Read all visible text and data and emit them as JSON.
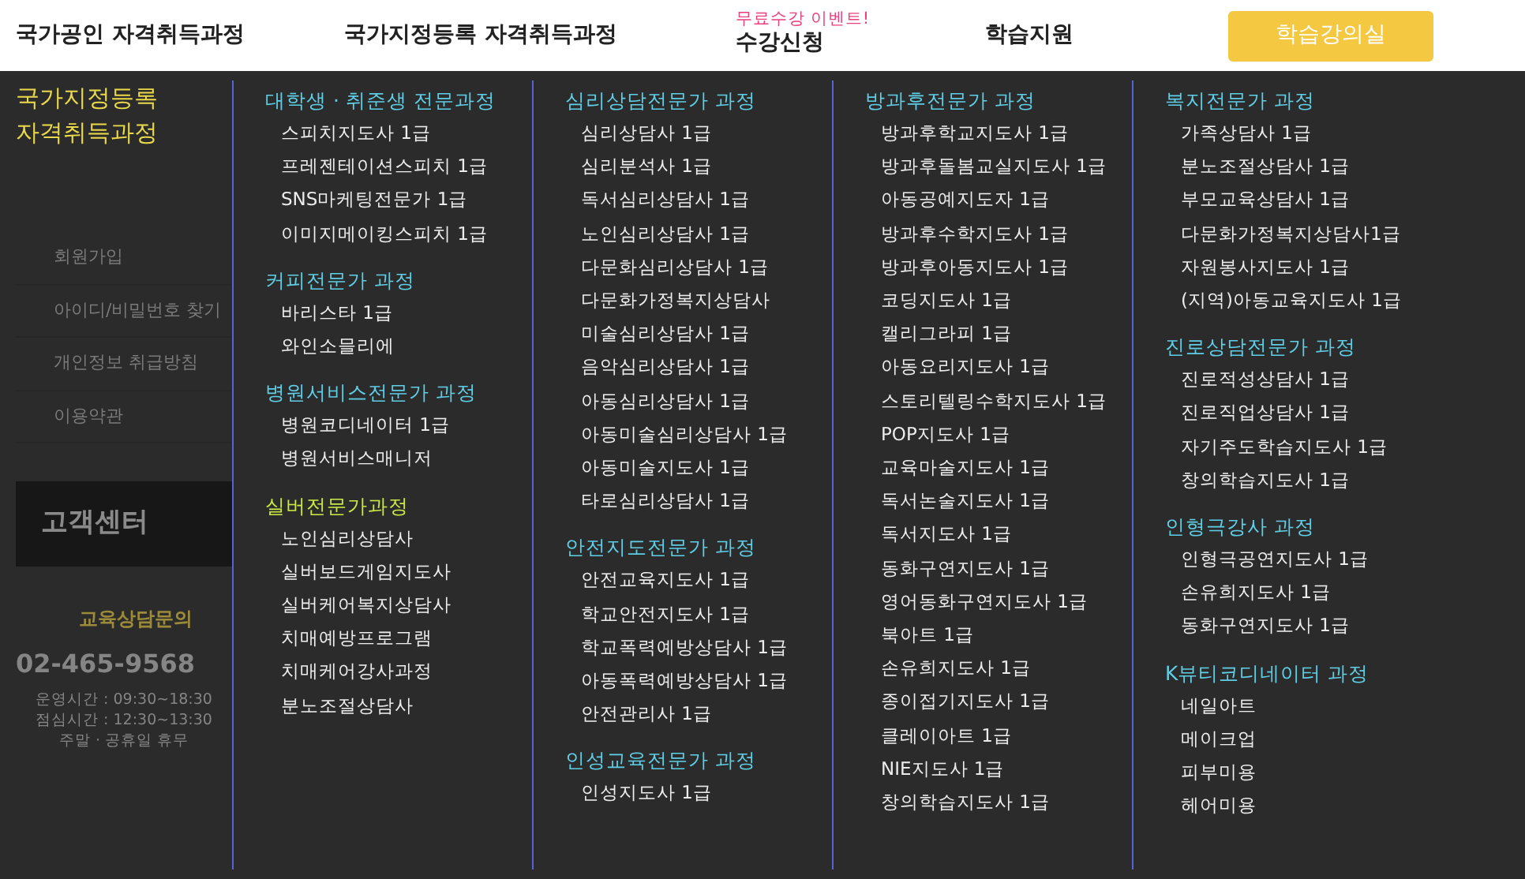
{
  "nav": {
    "items": [
      {
        "label": "국가공인 자격취득과정"
      },
      {
        "label": "국가지정등록 자격취득과정"
      },
      {
        "label": "수강신청",
        "badge": "무료수강 이벤트!"
      },
      {
        "label": "학습지원"
      }
    ],
    "button": "학습강의실"
  },
  "menu_title": "국가지정등록 자격취득과정",
  "sidebar": {
    "links": [
      "회원가입",
      "아이디/비밀번호 찾기",
      "개인정보 취급방침",
      "이용약관"
    ],
    "service_title": "고객센터",
    "contact_label": "교육상담문의",
    "phone": "02-465-9568",
    "hours": [
      "운영시간 : 09:30~18:30",
      "점심시간 : 12:30~13:30",
      "주말 · 공휴일 휴무"
    ]
  },
  "columns": [
    [
      {
        "title": "대학생 · 취준생 전문과정",
        "color": "#5fcde4",
        "items": [
          "스피치지도사 1급",
          "프레젠테이션스피치 1급",
          "SNS마케팅전문가 1급",
          "이미지메이킹스피치 1급"
        ]
      },
      {
        "title": "커피전문가 과정",
        "color": "#5fcde4",
        "items": [
          "바리스타 1급",
          "와인소믈리에"
        ]
      },
      {
        "title": "병원서비스전문가 과정",
        "color": "#5fcde4",
        "items": [
          "병원코디네이터 1급",
          "병원서비스매니저"
        ]
      },
      {
        "title": "실버전문가과정",
        "color": "#c9e844",
        "items": [
          "노인심리상담사",
          "실버보드게임지도사",
          "실버케어복지상담사",
          "치매예방프로그램",
          "치매케어강사과정",
          "분노조절상담사"
        ]
      }
    ],
    [
      {
        "title": "심리상담전문가 과정",
        "color": "#5fcde4",
        "items": [
          "심리상담사 1급",
          "심리분석사 1급",
          "독서심리상담사 1급",
          "노인심리상담사 1급",
          "다문화심리상담사 1급",
          "다문화가정복지상담사",
          "미술심리상담사 1급",
          "음악심리상담사 1급",
          "아동심리상담사 1급",
          "아동미술심리상담사 1급",
          "아동미술지도사 1급",
          "타로심리상담사 1급"
        ]
      },
      {
        "title": "안전지도전문가 과정",
        "color": "#5fcde4",
        "items": [
          "안전교육지도사 1급",
          "학교안전지도사 1급",
          "학교폭력예방상담사 1급",
          "아동폭력예방상담사 1급",
          "안전관리사 1급"
        ]
      },
      {
        "title": "인성교육전문가 과정",
        "color": "#5fcde4",
        "items": [
          "인성지도사 1급"
        ]
      }
    ],
    [
      {
        "title": "방과후전문가 과정",
        "color": "#5fcde4",
        "items": [
          "방과후학교지도사 1급",
          "방과후돌봄교실지도사 1급",
          "아동공예지도자 1급",
          "방과후수학지도사 1급",
          "방과후아동지도사 1급",
          "코딩지도사 1급",
          "캘리그라피 1급",
          "아동요리지도사 1급",
          "스토리텔링수학지도사 1급",
          "POP지도사 1급",
          "교육마술지도사 1급",
          "독서논술지도사 1급",
          "독서지도사 1급",
          "동화구연지도사 1급",
          "영어동화구연지도사 1급",
          "북아트 1급",
          "손유희지도사 1급",
          "종이접기지도사 1급",
          "클레이아트 1급",
          "NIE지도사 1급",
          "창의학습지도사 1급"
        ]
      }
    ],
    [
      {
        "title": "복지전문가 과정",
        "color": "#5fcde4",
        "items": [
          "가족상담사 1급",
          "분노조절상담사 1급",
          "부모교육상담사 1급",
          "다문화가정복지상담사1급",
          "자원봉사지도사 1급",
          "(지역)아동교육지도사 1급"
        ]
      },
      {
        "title": "진로상담전문가 과정",
        "color": "#5fcde4",
        "items": [
          "진로적성상담사 1급",
          "진로직업상담사 1급",
          "자기주도학습지도사 1급",
          "창의학습지도사 1급"
        ]
      },
      {
        "title": "인형극강사 과정",
        "color": "#5fcde4",
        "items": [
          "인형극공연지도사 1급",
          "손유희지도사 1급",
          "동화구연지도사 1급"
        ]
      },
      {
        "title": "K뷰티코디네이터 과정",
        "color": "#5fcde4",
        "items": [
          "네일아트",
          "메이크업",
          "피부미용",
          "헤어미용"
        ]
      }
    ]
  ]
}
